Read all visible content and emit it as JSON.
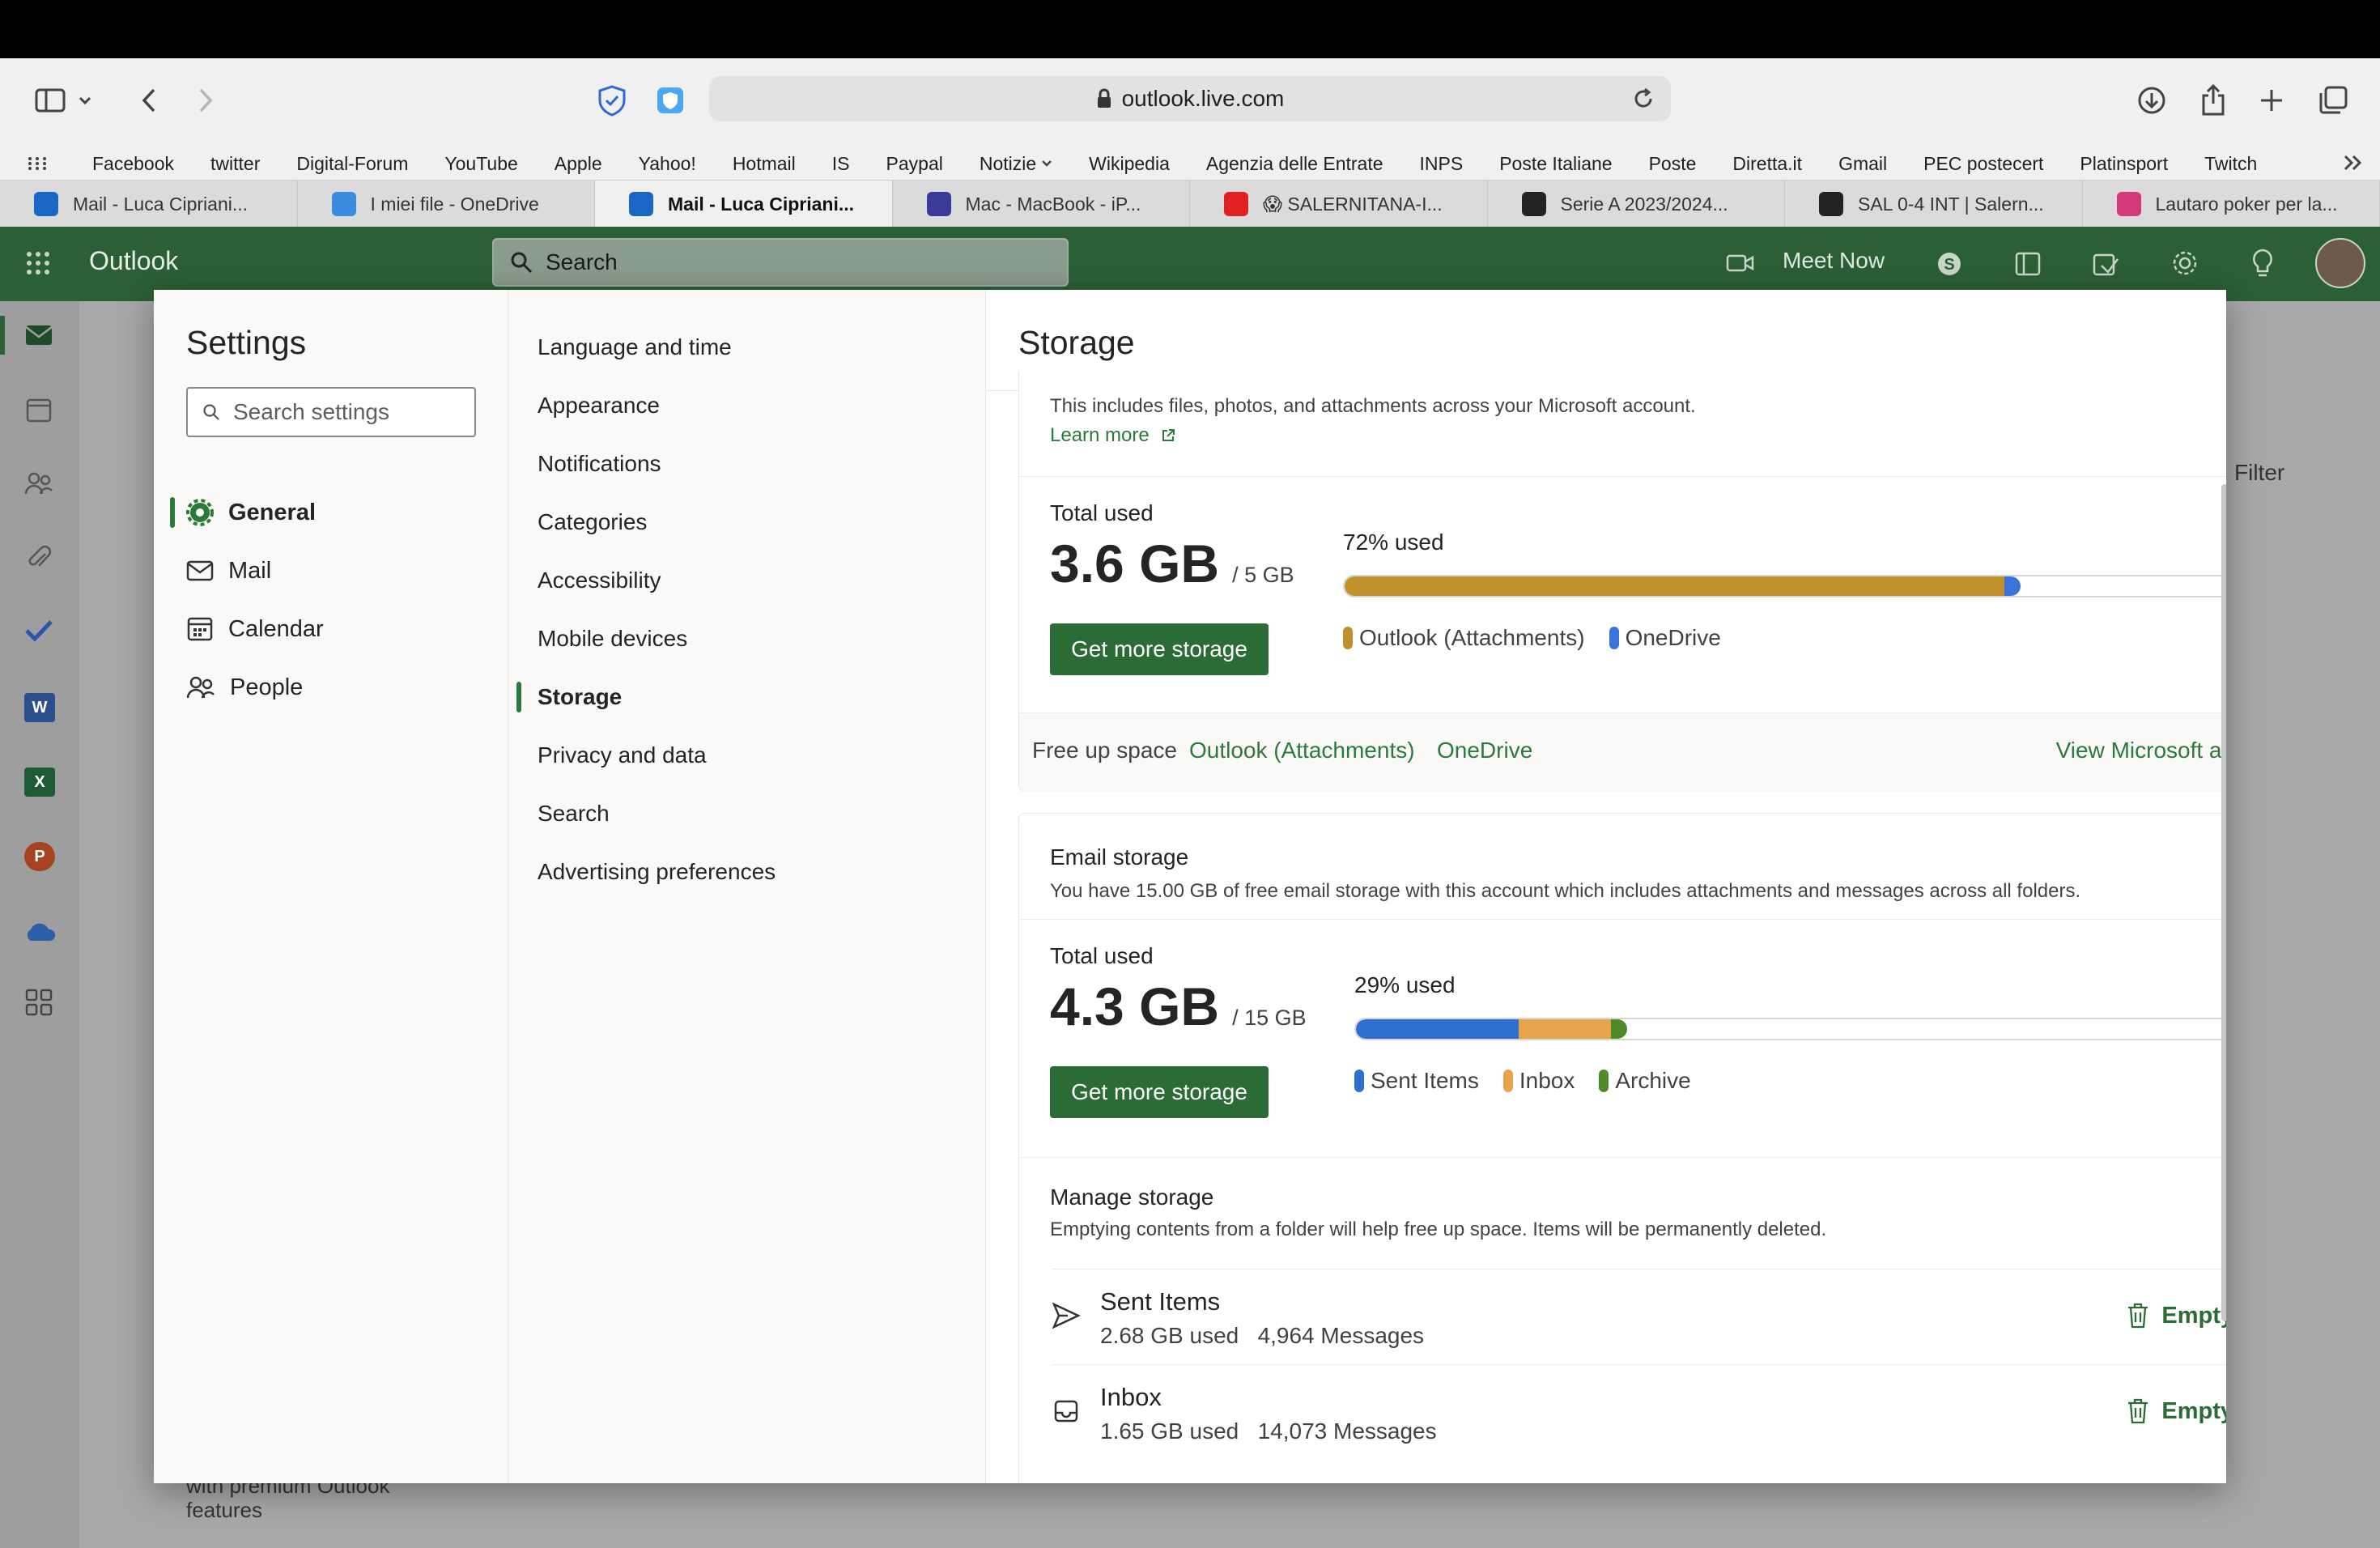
{
  "browser": {
    "url": "outlook.live.com",
    "bookmarks": [
      "Facebook",
      "twitter",
      "Digital-Forum",
      "YouTube",
      "Apple",
      "Yahoo!",
      "Hotmail",
      "IS",
      "Paypal",
      "Notizie",
      "Wikipedia",
      "Agenzia delle Entrate",
      "INPS",
      "Poste Italiane",
      "Poste",
      "Diretta.it",
      "Gmail",
      "PEC postecert",
      "Platinsport",
      "Twitch"
    ],
    "tabs": [
      {
        "label": "Mail - Luca Cipriani...",
        "color": "#1a67c6"
      },
      {
        "label": "I miei file - OneDrive",
        "color": "#3a8be0"
      },
      {
        "label": "Mail - Luca Cipriani...",
        "color": "#1a67c6"
      },
      {
        "label": "Mac - MacBook - iP...",
        "color": "#3a3a9a"
      },
      {
        "label": "😱 SALERNITANA-I...",
        "color": "#e02020"
      },
      {
        "label": "Serie A 2023/2024...",
        "color": "#222222"
      },
      {
        "label": "SAL 0-4 INT | Salern...",
        "color": "#222222"
      },
      {
        "label": "Lautaro poker per la...",
        "color": "#d4387a"
      }
    ],
    "active_tab": 2
  },
  "outlook": {
    "app_title": "Outlook",
    "search_placeholder": "Search",
    "meet_now": "Meet Now",
    "filter": "Filter",
    "promo": "with premium Outlook",
    "promo2": "features"
  },
  "settings": {
    "title": "Settings",
    "search_placeholder": "Search settings",
    "nav": [
      {
        "label": "General",
        "icon": "gear-icon",
        "selected": true
      },
      {
        "label": "Mail",
        "icon": "mail-icon",
        "selected": false
      },
      {
        "label": "Calendar",
        "icon": "calendar-icon",
        "selected": false
      },
      {
        "label": "People",
        "icon": "people-icon",
        "selected": false
      }
    ],
    "subnav": [
      "Language and time",
      "Appearance",
      "Notifications",
      "Categories",
      "Accessibility",
      "Mobile devices",
      "Storage",
      "Privacy and data",
      "Search",
      "Advertising preferences"
    ],
    "subnav_selected": 6
  },
  "storage": {
    "title": "Storage",
    "cloud_desc": "This includes files, photos, and attachments across your Microsoft account.",
    "learn_more": "Learn more",
    "total_used_label": "Total used",
    "cloud": {
      "used": "3.6 GB",
      "of": "/ 5 GB",
      "percent_label": "72% used",
      "segments": [
        {
          "name": "Outlook (Attachments)",
          "fraction": 0.703,
          "color": "#c0912b"
        },
        {
          "name": "OneDrive",
          "fraction": 0.017,
          "color": "#3b73d9"
        }
      ],
      "button": "Get more storage"
    },
    "free_up": {
      "label": "Free up space",
      "links": [
        "Outlook (Attachments)",
        "OneDrive"
      ],
      "view_account": "View Microsoft account"
    },
    "email": {
      "title": "Email storage",
      "desc": "You have 15.00 GB of free email storage with this account which includes attachments and messages across all folders.",
      "used": "4.3 GB",
      "of": "/ 15 GB",
      "percent_label": "29% used",
      "segments": [
        {
          "name": "Sent Items",
          "fraction": 0.175,
          "color": "#2f6fd0"
        },
        {
          "name": "Inbox",
          "fraction": 0.1,
          "color": "#e8a44d"
        },
        {
          "name": "Archive",
          "fraction": 0.017,
          "color": "#4e8a2a"
        }
      ],
      "button": "Get more storage"
    },
    "manage": {
      "title": "Manage storage",
      "desc": "Emptying contents from a folder will help free up space. Items will be permanently deleted.",
      "folders": [
        {
          "name": "Sent Items",
          "size": "2.68 GB used",
          "messages": "4,964 Messages",
          "icon": "send-icon",
          "action": "Empty"
        },
        {
          "name": "Inbox",
          "size": "1.65 GB used",
          "messages": "14,073 Messages",
          "icon": "inbox-icon",
          "action": "Empty"
        }
      ]
    }
  }
}
